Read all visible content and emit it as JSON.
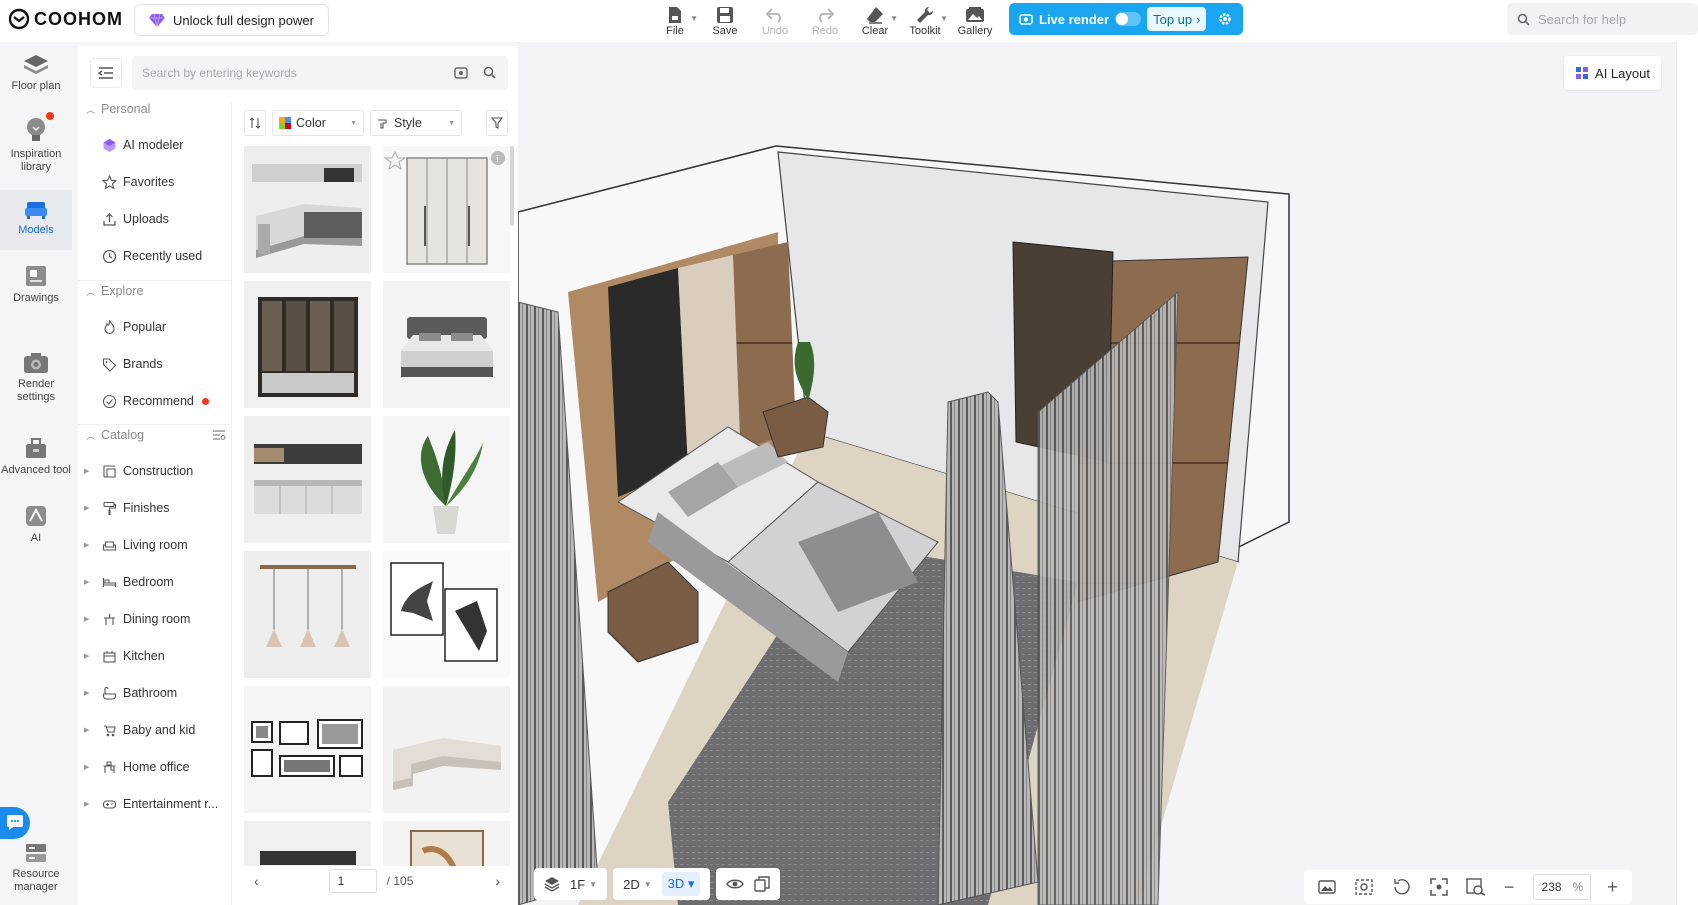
{
  "app": {
    "brand": "COOHOM",
    "unlock_label": "Unlock full design power"
  },
  "toolbar": [
    {
      "label": "File",
      "icon": "file-icon",
      "caret": true,
      "disabled": false
    },
    {
      "label": "Save",
      "icon": "save-icon",
      "caret": false,
      "disabled": false
    },
    {
      "label": "Undo",
      "icon": "undo-icon",
      "caret": false,
      "disabled": true
    },
    {
      "label": "Redo",
      "icon": "redo-icon",
      "caret": false,
      "disabled": true
    },
    {
      "label": "Clear",
      "icon": "eraser-icon",
      "caret": true,
      "disabled": false
    },
    {
      "label": "Toolkit",
      "icon": "wrench-icon",
      "caret": true,
      "disabled": false
    },
    {
      "label": "Gallery",
      "icon": "gallery-icon",
      "caret": false,
      "disabled": false
    }
  ],
  "live_render": {
    "label": "Live render",
    "topup_label": "Top up",
    "accent": "#1aa5f0"
  },
  "help_search": {
    "placeholder": "Search for help"
  },
  "left_nav": [
    {
      "label": "Floor plan",
      "icon": "floor-plan-icon",
      "active": false
    },
    {
      "label": "Inspiration library",
      "icon": "lightbulb-icon",
      "active": false,
      "badge": true
    },
    {
      "label": "Models",
      "icon": "models-icon",
      "active": true
    },
    {
      "label": "Drawings",
      "icon": "drawings-icon",
      "active": false
    },
    {
      "label": "Render settings",
      "icon": "camera-icon",
      "active": false
    },
    {
      "label": "Advanced tool",
      "icon": "toolbox-icon",
      "active": false
    },
    {
      "label": "AI",
      "icon": "ai-icon",
      "active": false
    },
    {
      "label": "Resource manager",
      "icon": "resource-manager-icon",
      "active": false
    }
  ],
  "model_panel": {
    "search_placeholder": "Search by entering keywords",
    "sections": {
      "personal": "Personal",
      "explore": "Explore",
      "catalog": "Catalog"
    },
    "personal_items": [
      {
        "label": "AI modeler",
        "icon": "ai-modeler-icon"
      },
      {
        "label": "Favorites",
        "icon": "star-icon"
      },
      {
        "label": "Uploads",
        "icon": "upload-icon"
      },
      {
        "label": "Recently used",
        "icon": "clock-icon"
      }
    ],
    "explore_items": [
      {
        "label": "Popular",
        "icon": "flame-icon"
      },
      {
        "label": "Brands",
        "icon": "tag-icon"
      },
      {
        "label": "Recommend",
        "icon": "recommend-icon",
        "badge": true
      }
    ],
    "catalog_items": [
      {
        "label": "Construction",
        "icon": "construction-icon"
      },
      {
        "label": "Finishes",
        "icon": "paint-roller-icon"
      },
      {
        "label": "Living room",
        "icon": "sofa-icon"
      },
      {
        "label": "Bedroom",
        "icon": "bed-icon"
      },
      {
        "label": "Dining room",
        "icon": "dining-icon"
      },
      {
        "label": "Kitchen",
        "icon": "kitchen-icon"
      },
      {
        "label": "Bathroom",
        "icon": "bathtub-icon"
      },
      {
        "label": "Baby and kid",
        "icon": "stroller-icon"
      },
      {
        "label": "Home office",
        "icon": "desk-icon"
      },
      {
        "label": "Entertainment r..."
      }
    ],
    "filters": {
      "color": "Color",
      "style": "Style"
    },
    "thumbnails": [
      "kitchen-cabinet-thumbnail",
      "wardrobe-door-thumbnail",
      "open-wardrobe-thumbnail",
      "bed-thumbnail",
      "kitchen-set-thumbnail",
      "potted-plant-thumbnail",
      "pendant-lights-thumbnail",
      "horse-art-thumbnail",
      "photo-frames-thumbnail",
      "sectional-sofa-thumbnail",
      "tv-cabinet-thumbnail",
      "abstract-painting-thumbnail"
    ],
    "pagination": {
      "current": "1",
      "total": "/ 105"
    }
  },
  "canvas": {
    "ai_layout_label": "AI Layout",
    "floor": "1F",
    "view_2d": "2D",
    "view_3d": "3D",
    "zoom": "238",
    "zoom_unit": "%"
  }
}
